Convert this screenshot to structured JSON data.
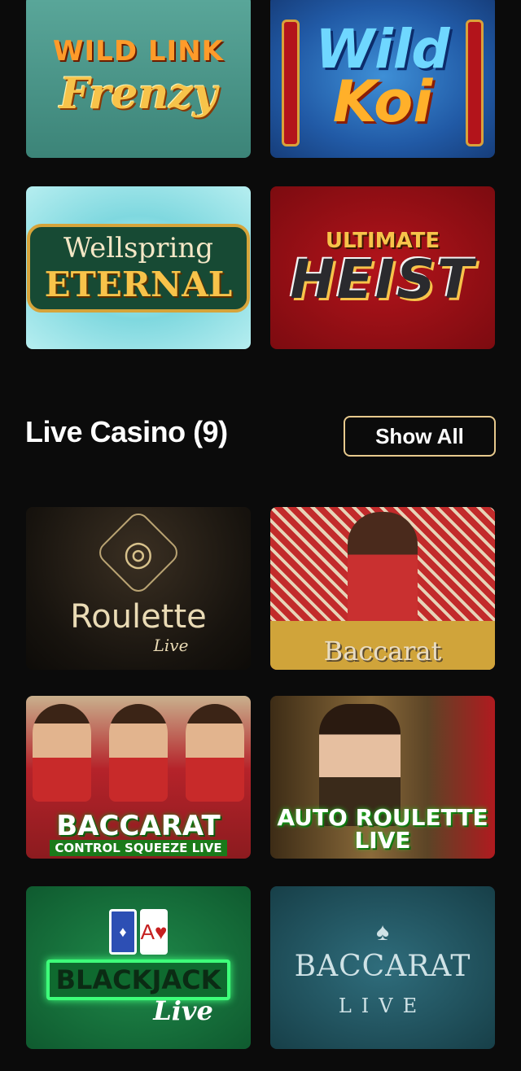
{
  "games": [
    {
      "line1": "WILD LINK",
      "line2": "Frenzy"
    },
    {
      "line1": "Wild",
      "line2": "Koi"
    },
    {
      "line1": "Wellspring",
      "line2": "ETERNAL"
    },
    {
      "line1": "ULTIMATE",
      "line2": "HEIST"
    }
  ],
  "live_casino": {
    "title": "Live Casino (9)",
    "show_all_label": "Show All",
    "tiles": [
      {
        "line1": "Roulette",
        "line2": "Live"
      },
      {
        "line1": "Baccarat"
      },
      {
        "line1": "BACCARAT",
        "line2": "CONTROL SQUEEZE LIVE"
      },
      {
        "line1": "AUTO ROULETTE",
        "line2": "LIVE"
      },
      {
        "line1": "BLACKJACK",
        "line2": "Live",
        "card": "A"
      },
      {
        "line1": "BACCARAT",
        "line2": "LIVE"
      }
    ]
  }
}
